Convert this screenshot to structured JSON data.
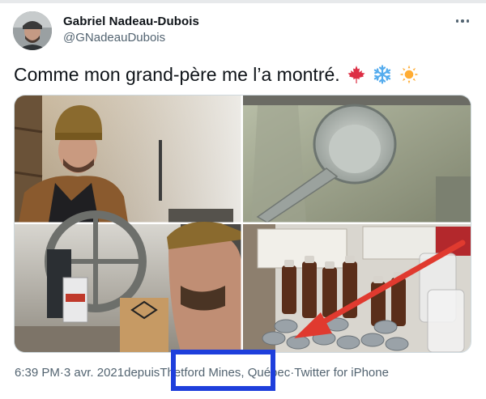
{
  "tweet": {
    "author_name": "Gabriel Nadeau-Dubois",
    "author_handle": "@GNadeauDubois",
    "text": "Comme mon grand-père me l’a montré.",
    "emojis": [
      "maple-leaf-emoji",
      "snowflake-emoji",
      "sun-emoji"
    ],
    "more_icon": "more-dots-icon"
  },
  "media": {
    "count": 4,
    "images": [
      "man-with-brown-hat-in-sugar-shack",
      "metal-scoop-over-boiling-sap",
      "canning-machine-and-man-working",
      "syrup-bottles-and-cans-with-red-arrow"
    ]
  },
  "meta": {
    "time": "6:39 PM",
    "separator": " · ",
    "date": "3 avr. 2021",
    "from_prefix": " depuis ",
    "place_city": "Thetford Mines",
    "place_region": ", Québec",
    "source_separator": " · ",
    "source": "Twitter for iPhone"
  },
  "colors": {
    "annotation_box": "#1e3fdc",
    "annotation_arrow": "#e03a2f",
    "secondary_text": "#536471"
  }
}
